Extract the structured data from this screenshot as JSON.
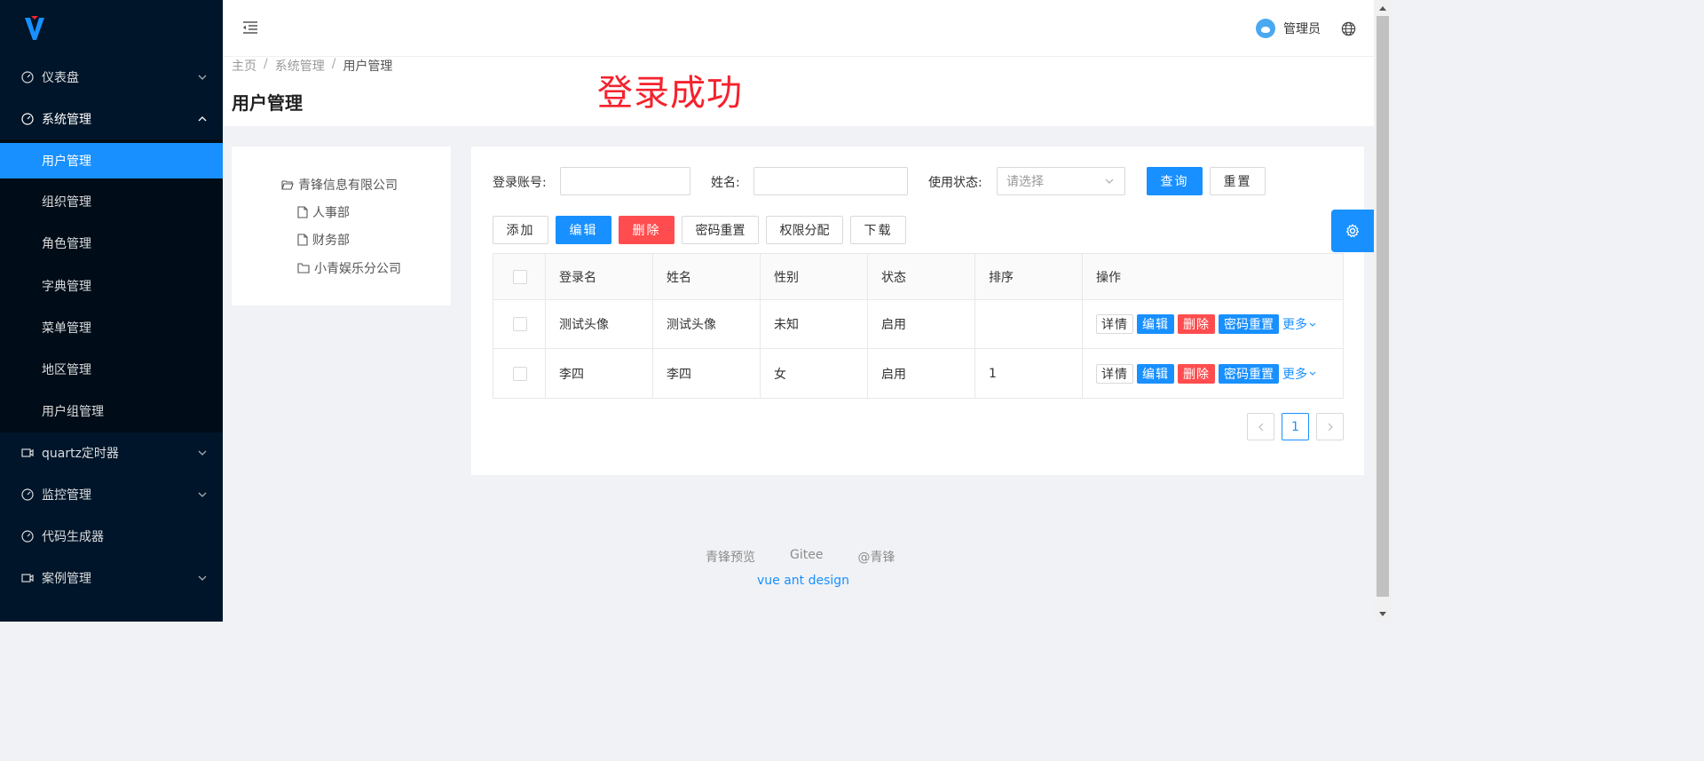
{
  "sidebar": {
    "menu": [
      {
        "label": "仪表盘",
        "icon": "dashboard-icon",
        "expanded": false
      },
      {
        "label": "系统管理",
        "icon": "dashboard-icon",
        "expanded": true
      },
      {
        "label": "quartz定时器",
        "icon": "video-icon",
        "expanded": false
      },
      {
        "label": "监控管理",
        "icon": "dashboard-icon",
        "expanded": false
      },
      {
        "label": "代码生成器",
        "icon": "dashboard-icon",
        "expanded": false
      },
      {
        "label": "案例管理",
        "icon": "video-icon",
        "expanded": false
      }
    ],
    "submenu": [
      {
        "label": "用户管理",
        "active": true
      },
      {
        "label": "组织管理"
      },
      {
        "label": "角色管理"
      },
      {
        "label": "字典管理"
      },
      {
        "label": "菜单管理"
      },
      {
        "label": "地区管理"
      },
      {
        "label": "用户组管理"
      }
    ]
  },
  "header": {
    "username": "管理员"
  },
  "page": {
    "breadcrumb": [
      "主页",
      "系统管理",
      "用户管理"
    ],
    "title": "用户管理",
    "message": "登录成功"
  },
  "tree": {
    "root": "青锋信息有限公司",
    "children": [
      "人事部",
      "财务部",
      "小青娱乐分公司"
    ]
  },
  "search": {
    "account_label": "登录账号:",
    "name_label": "姓名:",
    "status_label": "使用状态:",
    "status_placeholder": "请选择",
    "query_btn": "查询",
    "reset_btn": "重置"
  },
  "toolbar": {
    "add": "添加",
    "edit": "编辑",
    "delete": "删除",
    "reset_pwd": "密码重置",
    "perm": "权限分配",
    "download": "下载"
  },
  "table": {
    "columns": [
      "登录名",
      "姓名",
      "性别",
      "状态",
      "排序",
      "操作"
    ],
    "rows": [
      {
        "login": "测试头像",
        "name": "测试头像",
        "gender": "未知",
        "status": "启用",
        "sort": ""
      },
      {
        "login": "李四",
        "name": "李四",
        "gender": "女",
        "status": "启用",
        "sort": "1"
      }
    ],
    "actions": {
      "detail": "详情",
      "edit": "编辑",
      "delete": "删除",
      "reset_pwd": "密码重置",
      "more": "更多"
    }
  },
  "pagination": {
    "current": "1"
  },
  "footer": {
    "links": [
      "青锋预览",
      "Gitee",
      "@青锋"
    ],
    "copyright": "vue ant design"
  },
  "colors": {
    "primary": "#1890ff",
    "danger": "#ff4d4f",
    "sidebar": "#001529",
    "message": "#f5222d"
  }
}
